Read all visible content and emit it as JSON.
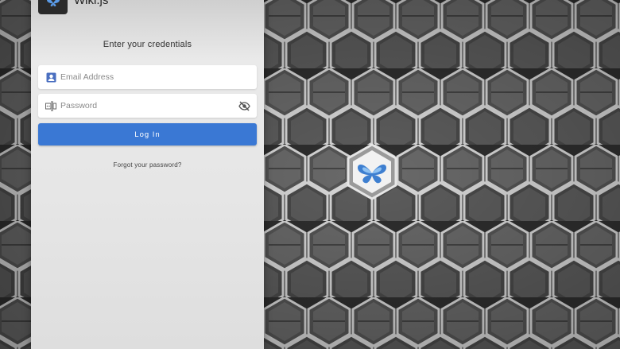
{
  "app": {
    "name": "Wiki.js"
  },
  "login": {
    "subtitle": "Enter your credentials",
    "email_placeholder": "Email Address",
    "password_placeholder": "Password",
    "login_label": "Log In",
    "forgot_label": "Forgot your password?"
  },
  "icons": {
    "email": "account-box-icon",
    "password": "password-dots-icon",
    "visibility": "eye-off-icon",
    "brand": "butterfly-logo-icon"
  },
  "colors": {
    "accent": "#3a78d4",
    "icon": "#4a6fc0"
  }
}
